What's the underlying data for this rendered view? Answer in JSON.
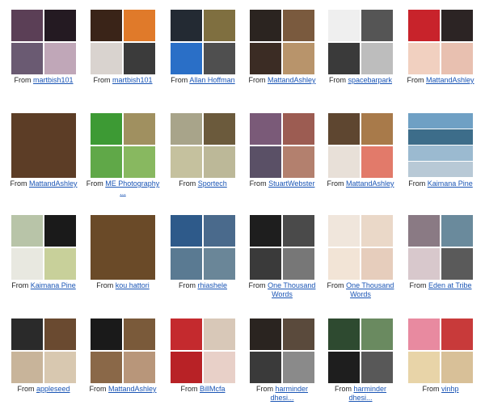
{
  "gallery": {
    "from_label": "From",
    "items": [
      {
        "author": "martbish101",
        "style": "quad",
        "tiles": [
          "#5b3f56",
          "#241a22",
          "#6a5a72",
          "#c0a7b8"
        ]
      },
      {
        "author": "martbish101",
        "style": "quad",
        "tiles": [
          "#3a2418",
          "#e07a2a",
          "#d9d3cf",
          "#3b3b3b"
        ]
      },
      {
        "author": "Allan Hoffman",
        "style": "quad",
        "tiles": [
          "#232a33",
          "#7f6f40",
          "#2a6fc7",
          "#4f4f4f"
        ]
      },
      {
        "author": "MattandAshley",
        "style": "quad",
        "tiles": [
          "#2b2420",
          "#7a5a3e",
          "#3b2c24",
          "#b8946b"
        ]
      },
      {
        "author": "spacebarpark",
        "style": "quad",
        "tiles": [
          "#efefef",
          "#555555",
          "#3a3a3a",
          "#bdbdbd"
        ]
      },
      {
        "author": "MattandAshley",
        "style": "quad",
        "tiles": [
          "#c8232b",
          "#2c2424",
          "#f1d0c0",
          "#e8c0b0"
        ]
      },
      {
        "author": "MattandAshley",
        "style": "full",
        "tiles": [
          "#5c3d26"
        ]
      },
      {
        "author": "ME Photography",
        "author2": "...",
        "style": "quad",
        "tiles": [
          "#3d9a34",
          "#a09060",
          "#60a848",
          "#88b860"
        ]
      },
      {
        "author": "Sportech",
        "style": "quad",
        "tiles": [
          "#a8a48a",
          "#6b5a3c",
          "#c5c19e",
          "#bcb898"
        ]
      },
      {
        "author": "StuartWebster",
        "style": "quad",
        "tiles": [
          "#7a5a78",
          "#9c5c52",
          "#5a5066",
          "#b3806e"
        ]
      },
      {
        "author": "MattandAshley",
        "style": "quad",
        "tiles": [
          "#5e4630",
          "#a87a4a",
          "#e8e0d8",
          "#e27a6a"
        ]
      },
      {
        "author": "Kaimana Pine",
        "style": "strips",
        "tiles": [
          "#6fa0c4",
          "#3d6d8a",
          "#9bbad0",
          "#b8c9d6"
        ]
      },
      {
        "author": "Kaimana Pine",
        "style": "quad",
        "tiles": [
          "#b8c4a8",
          "#1a1a1a",
          "#e8e8e0",
          "#c8d09a"
        ]
      },
      {
        "author": "kou hattori",
        "style": "full",
        "tiles": [
          "#6a4a28"
        ]
      },
      {
        "author": "rhiashele",
        "style": "quad",
        "tiles": [
          "#2e5a8a",
          "#4a6a8c",
          "#5a7a92",
          "#6a8698"
        ]
      },
      {
        "author": "One Thousand",
        "author2": "Words",
        "style": "quad",
        "tiles": [
          "#1e1e1e",
          "#4a4a4a",
          "#3a3a3a",
          "#777777"
        ]
      },
      {
        "author": "One Thousand",
        "author2": "Words",
        "style": "quad",
        "tiles": [
          "#f0e6dc",
          "#ead8c8",
          "#f2e4d6",
          "#e6cdbc"
        ]
      },
      {
        "author": "Eden at Tribe",
        "style": "quad",
        "tiles": [
          "#8a7a84",
          "#6a8a9c",
          "#d8c8cc",
          "#5a5a5a"
        ]
      },
      {
        "author": "appleseed",
        "style": "quad",
        "tiles": [
          "#2a2a2a",
          "#6a4a30",
          "#c8b49a",
          "#d8c8b0"
        ]
      },
      {
        "author": "MattandAshley",
        "style": "quad",
        "tiles": [
          "#1a1a1a",
          "#7a5a3a",
          "#8a6848",
          "#b8967a"
        ]
      },
      {
        "author": "BillMcfa",
        "style": "quad",
        "tiles": [
          "#c42a2e",
          "#d8c8b8",
          "#b82226",
          "#e8d0c8"
        ]
      },
      {
        "author": "harminder",
        "author2": "dhesi...",
        "style": "quad",
        "tiles": [
          "#2a2420",
          "#5a4a3c",
          "#3a3a3a",
          "#8a8a8a"
        ]
      },
      {
        "author": "harminder",
        "author2": "dhesi...",
        "style": "quad",
        "tiles": [
          "#2e4a30",
          "#6a8a60",
          "#1e1e1e",
          "#585858"
        ]
      },
      {
        "author": "vinhp",
        "style": "quad",
        "tiles": [
          "#e88aa0",
          "#c83a3a",
          "#e8d4a8",
          "#d8c098"
        ]
      }
    ]
  }
}
